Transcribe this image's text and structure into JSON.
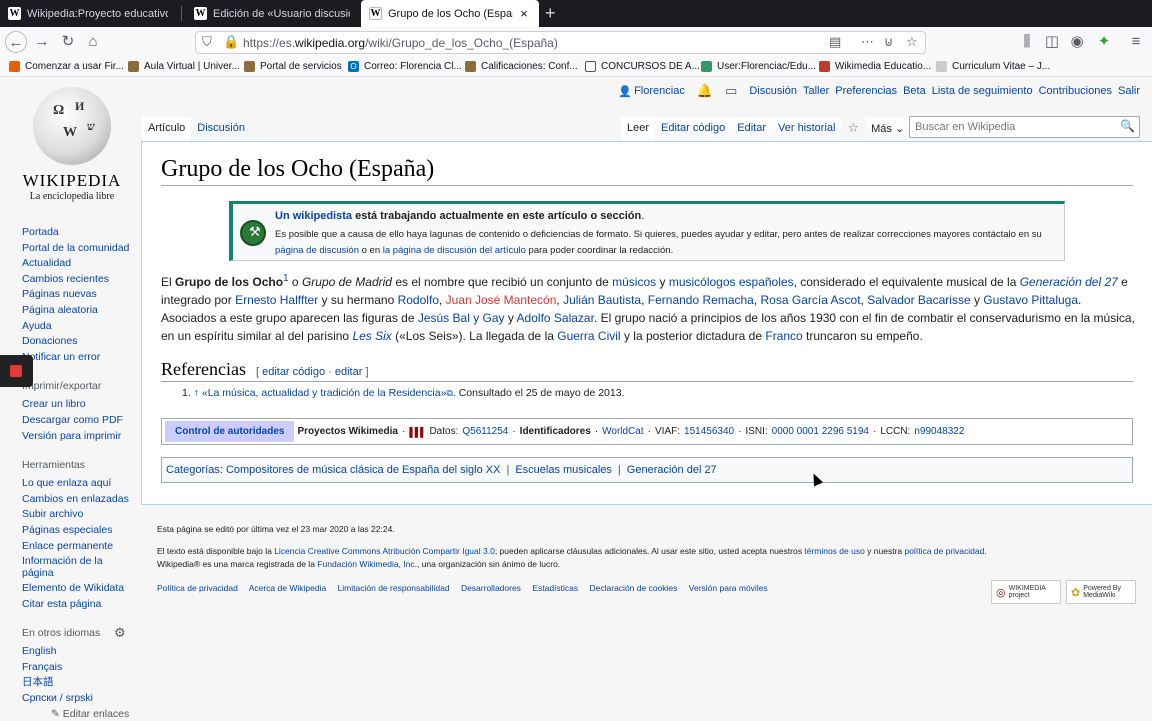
{
  "browser": {
    "tabs": [
      {
        "title": "Wikipedia:Proyecto educativo/Ca"
      },
      {
        "title": "Edición de «Usuario discusión:Fl"
      },
      {
        "title": "Grupo de los Ocho (España) - W"
      }
    ],
    "url_prefix": "https://es.",
    "url_domain": "wikipedia.org",
    "url_path": "/wiki/Grupo_de_los_Ocho_(España)",
    "bookmarks": [
      {
        "label": "Comenzar a usar Fir...",
        "color": "#e66000"
      },
      {
        "label": "Aula Virtual | Univer...",
        "color": "#8a6d3b"
      },
      {
        "label": "Portal de servicios",
        "color": "#8a6d3b"
      },
      {
        "label": "Correo: Florencia Cl...",
        "color": "#0072c6"
      },
      {
        "label": "Calificaciones: Conf...",
        "color": "#8a6d3b"
      },
      {
        "label": "CONCURSOS DE A...",
        "color": "#555555"
      },
      {
        "label": "User:Florenciac/Edu...",
        "color": "#339966"
      },
      {
        "label": "Wikimedia Educatio...",
        "color": "#c0392b"
      },
      {
        "label": "Curriculum Vitae – J...",
        "color": "#cccccc"
      }
    ]
  },
  "logo": {
    "wordmark": "Wikipedia",
    "tagline": "La enciclopedia libre"
  },
  "sidebar": {
    "main": [
      "Portada",
      "Portal de la comunidad",
      "Actualidad",
      "Cambios recientes",
      "Páginas nuevas",
      "Página aleatoria",
      "Ayuda",
      "Donaciones",
      "Notificar un error"
    ],
    "print_head": "Imprimir/exportar",
    "print": [
      "Crear un libro",
      "Descargar como PDF",
      "Versión para imprimir"
    ],
    "tools_head": "Herramientas",
    "tools": [
      "Lo que enlaza aquí",
      "Cambios en enlazadas",
      "Subir archivo",
      "Páginas especiales",
      "Enlace permanente",
      "Información de la página",
      "Elemento de Wikidata",
      "Citar esta página"
    ],
    "lang_head": "En otros idiomas",
    "langs": [
      "English",
      "Français",
      "日本語",
      "Српски / srpski"
    ],
    "edit_links": "Editar enlaces"
  },
  "personal": {
    "user": "Florenciac",
    "links": [
      "Discusión",
      "Taller",
      "Preferencias",
      "Beta",
      "Lista de seguimiento",
      "Contribuciones",
      "Salir"
    ]
  },
  "tabs": {
    "left": [
      "Artículo",
      "Discusión"
    ],
    "right": [
      "Leer",
      "Editar código",
      "Editar",
      "Ver historial"
    ],
    "more": "Más",
    "search_placeholder": "Buscar en Wikipedia"
  },
  "article": {
    "title": "Grupo de los Ocho (España)",
    "notice": {
      "title_link": "Un wikipedista",
      "title_rest": " está trabajando actualmente en este artículo o sección",
      "title_end": ".",
      "body_1": "Es posible que a causa de ello haya lagunas de contenido o deficiencias de formato. Si quieres, puedes ayudar y editar, pero antes de realizar correcciones mayores contáctalo en su ",
      "body_link1": "página de discusión",
      "body_2": " o en ",
      "body_link2": "la página de discusión del artículo",
      "body_3": " para poder coordinar la redacción."
    },
    "p": {
      "t1": "El ",
      "bold": "Grupo de los Ocho",
      "sup": "1",
      "t2": "  o ",
      "ital": "Grupo de Madrid",
      "t3": " es el nombre que recibió un conjunto de ",
      "l1": "músicos",
      "t4": " y ",
      "l2": "musicólogos españoles",
      "t5": ", considerado el equivalente musical de la ",
      "l3": "Generación del 27",
      "t6": " e integrado por ",
      "l4": "Ernesto Halffter",
      "t7": " y su hermano ",
      "l5": "Rodolfo",
      "t8": ", ",
      "l6": "Juan José Mantecón",
      "t9": ", ",
      "l7": "Julián Bautista",
      "t10": ", ",
      "l8": "Fernando Remacha",
      "t11": ", ",
      "l9": "Rosa García Ascot",
      "t12": ", ",
      "l10": "Salvador Bacarisse",
      "t13": " y ",
      "l11": "Gustavo Pittaluga",
      "t14": ". Asociados a este grupo aparecen las figuras de ",
      "l12": "Jesús Bal y Gay",
      "t15": " y ",
      "l13": "Adolfo Salazar",
      "t16": ". El grupo nació a principios de los años 1930 con el fin de combatir el conservadurismo en la música, en un espíritu similar al del parisino ",
      "l14": "Les Six",
      "t17": " («Los Seis»). La llegada de la ",
      "l15": "Guerra Civil",
      "t18": " y la posterior dictadura de ",
      "l16": "Franco",
      "t19": " truncaron su empeño."
    },
    "refs_title": "Referencias",
    "refs_edit_code": "editar código",
    "refs_edit": "editar",
    "ref1_num": "1.",
    "ref1_arrow": "↑",
    "ref1_link": "«La música, actualidad y tradición de la Residencia»",
    "ref1_rest": ". Consultado el 25 de mayo de 2013.",
    "authority": {
      "head": "Control de autoridades",
      "projects": "Proyectos Wikimedia",
      "datos": "Datos:",
      "q": "Q5611254",
      "ids": "Identificadores",
      "worldcat": "WorldCat",
      "viaf_label": "VIAF:",
      "viaf": "151456340",
      "isni_label": "ISNI:",
      "isni": "0000 0001 2296 5194",
      "lccn_label": "LCCN:",
      "lccn": "n99048322"
    },
    "categories_label": "Categorías",
    "categories": [
      "Compositores de música clásica de España del siglo XX",
      "Escuelas musicales",
      "Generación del 27"
    ]
  },
  "footer": {
    "edited": "Esta página se editó por última vez el 23 mar 2020 a las 22:24.",
    "lic1": "El texto está disponible bajo la ",
    "lic_link": "Licencia Creative Commons Atribución Compartir Igual 3.0",
    "lic2": "; pueden aplicarse cláusulas adicionales. Al usar este sitio, usted acepta nuestros ",
    "terms": "términos de uso",
    "lic3": " y nuestra ",
    "privacy": "política de privacidad",
    "lic4": ".",
    "tm1": "Wikipedia® es una marca registrada de la ",
    "tm_link": "Fundación Wikimedia, Inc.",
    "tm2": ", una organización sin ánimo de lucro.",
    "links": [
      "Política de privacidad",
      "Acerca de Wikipedia",
      "Limitación de responsabilidad",
      "Desarrolladores",
      "Estadísticas",
      "Declaración de cookies",
      "Versión para móviles"
    ],
    "badge1": "WIKIMEDIA project",
    "badge2": "Powered By MediaWiki"
  }
}
